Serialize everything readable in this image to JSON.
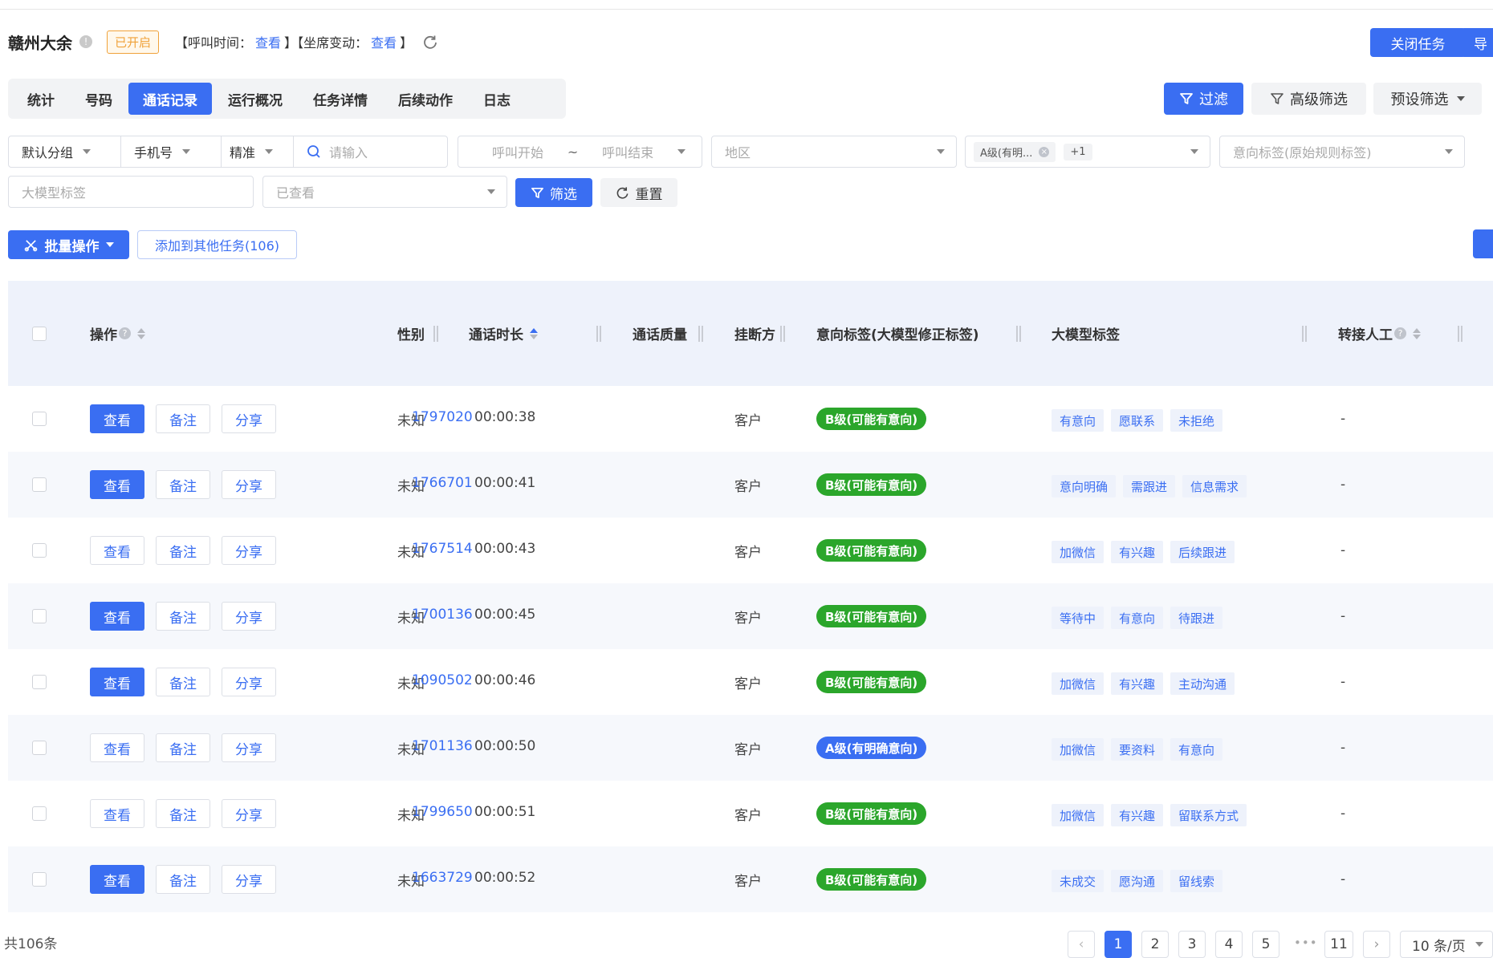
{
  "header": {
    "title": "赣州大余",
    "status": "已开启",
    "call_time_label": "【呼叫时间：",
    "call_time_link": "查看",
    "call_time_end": "】",
    "seat_change_label": "【坐席变动：",
    "seat_change_link": "查看",
    "seat_change_end": "】",
    "close_task_label": "关闭任务",
    "export_label": "导"
  },
  "tabs": [
    "统计",
    "号码",
    "通话记录",
    "运行概况",
    "任务详情",
    "后续动作",
    "日志"
  ],
  "active_tab": "通话记录",
  "toolbar": {
    "filter_label": "过滤",
    "advanced_label": "高级筛选",
    "preset_label": "预设筛选"
  },
  "filters": {
    "group": "默认分组",
    "phone_type": "手机号",
    "match": "精准",
    "search_placeholder": "请输入",
    "call_start_placeholder": "呼叫开始",
    "range_sep": "~",
    "call_end_placeholder": "呼叫结束",
    "region_placeholder": "地区",
    "intent_chip": "A级(有明...",
    "intent_more": "+1",
    "intent_tag_placeholder": "意向标签(原始规则标签)",
    "llm_tag_placeholder": "大模型标签",
    "viewed_placeholder": "已查看",
    "sift_label": "筛选",
    "reset_label": "重置"
  },
  "actions": {
    "batch_label": "批量操作",
    "add_other_label": "添加到其他任务(106)"
  },
  "table": {
    "columns": {
      "op": "操作",
      "gender": "性别",
      "duration": "通话时长",
      "quality": "通话质量",
      "hangup": "挂断方",
      "intent": "意向标签(大模型修正标签)",
      "llm": "大模型标签",
      "transfer": "转接人工"
    },
    "btn_view": "查看",
    "btn_note": "备注",
    "btn_share": "分享",
    "rows": [
      {
        "gender": "未知",
        "phone": "1797020",
        "duration": "00:00:38",
        "hangup": "客户",
        "intent": "B级(可能有意向)",
        "level": "b",
        "tags": [
          "有意向",
          "愿联系",
          "未拒绝"
        ],
        "transfer": "-",
        "viewed": true
      },
      {
        "gender": "未知",
        "phone": "1766701",
        "duration": "00:00:41",
        "hangup": "客户",
        "intent": "B级(可能有意向)",
        "level": "b",
        "tags": [
          "意向明确",
          "需跟进",
          "信息需求"
        ],
        "transfer": "-",
        "viewed": true
      },
      {
        "gender": "未知",
        "phone": "1767514",
        "duration": "00:00:43",
        "hangup": "客户",
        "intent": "B级(可能有意向)",
        "level": "b",
        "tags": [
          "加微信",
          "有兴趣",
          "后续跟进"
        ],
        "transfer": "-",
        "viewed": false
      },
      {
        "gender": "未知",
        "phone": "1700136",
        "duration": "00:00:45",
        "hangup": "客户",
        "intent": "B级(可能有意向)",
        "level": "b",
        "tags": [
          "等待中",
          "有意向",
          "待跟进"
        ],
        "transfer": "-",
        "viewed": true
      },
      {
        "gender": "未知",
        "phone": "1090502",
        "duration": "00:00:46",
        "hangup": "客户",
        "intent": "B级(可能有意向)",
        "level": "b",
        "tags": [
          "加微信",
          "有兴趣",
          "主动沟通"
        ],
        "transfer": "-",
        "viewed": true
      },
      {
        "gender": "未知",
        "phone": "1701136",
        "duration": "00:00:50",
        "hangup": "客户",
        "intent": "A级(有明确意向)",
        "level": "a",
        "tags": [
          "加微信",
          "要资料",
          "有意向"
        ],
        "transfer": "-",
        "viewed": false
      },
      {
        "gender": "未知",
        "phone": "1799650",
        "duration": "00:00:51",
        "hangup": "客户",
        "intent": "B级(可能有意向)",
        "level": "b",
        "tags": [
          "加微信",
          "有兴趣",
          "留联系方式"
        ],
        "transfer": "-",
        "viewed": false
      },
      {
        "gender": "未知",
        "phone": "1663729",
        "duration": "00:00:52",
        "hangup": "客户",
        "intent": "B级(可能有意向)",
        "level": "b",
        "tags": [
          "未成交",
          "愿沟通",
          "留线索"
        ],
        "transfer": "-",
        "viewed": true
      }
    ]
  },
  "footer": {
    "total": "共106条",
    "pages": [
      "1",
      "2",
      "3",
      "4",
      "5"
    ],
    "ellipsis": "•••",
    "last_page": "11",
    "current_page": "1",
    "page_size": "10 条/页"
  },
  "colors": {
    "primary": "#3a6ef2",
    "green": "#2ba62b",
    "warning": "#f0a23a"
  }
}
